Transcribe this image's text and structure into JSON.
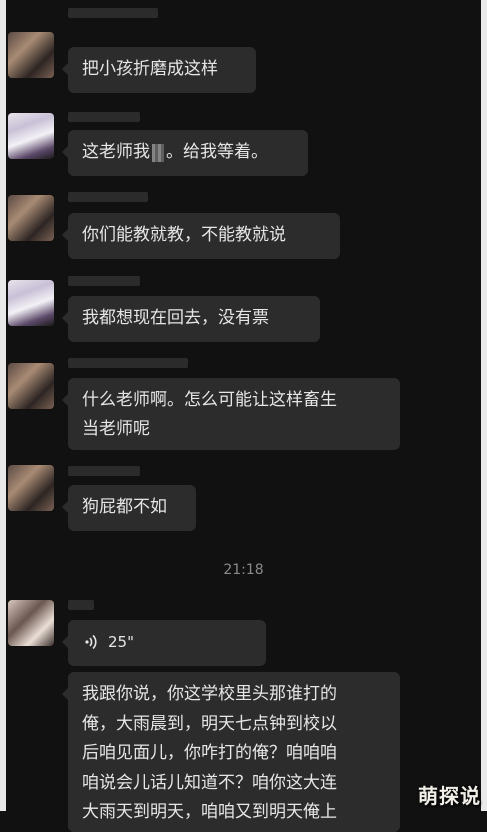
{
  "messages": [
    {
      "text": "把小孩折磨成这样"
    },
    {
      "text_before": "这老师我",
      "text_after": "。给我等着。"
    },
    {
      "text": "你们能教就教，不能教就说"
    },
    {
      "text": "我都想现在回去，没有票"
    },
    {
      "line1": "什么老师啊。怎么可能让这样畜生",
      "line2": "当老师呢"
    },
    {
      "text": "狗屁都不如"
    },
    {
      "voice_duration": "25\""
    },
    {
      "line1": "我跟你说，你这学校里头那谁打的",
      "line2": "俺，大雨晨到，明天七点钟到校以",
      "line3": "后咱见面儿，你咋打的俺？咱咱咱",
      "line4": "咱说会儿话儿知道不？咱你这大连",
      "line5": "大雨天到明天，咱咱又到明天俺上"
    }
  ],
  "timestamp": "21:18",
  "watermark": "萌探说",
  "icons": {
    "voice": "voice-wave-icon"
  }
}
